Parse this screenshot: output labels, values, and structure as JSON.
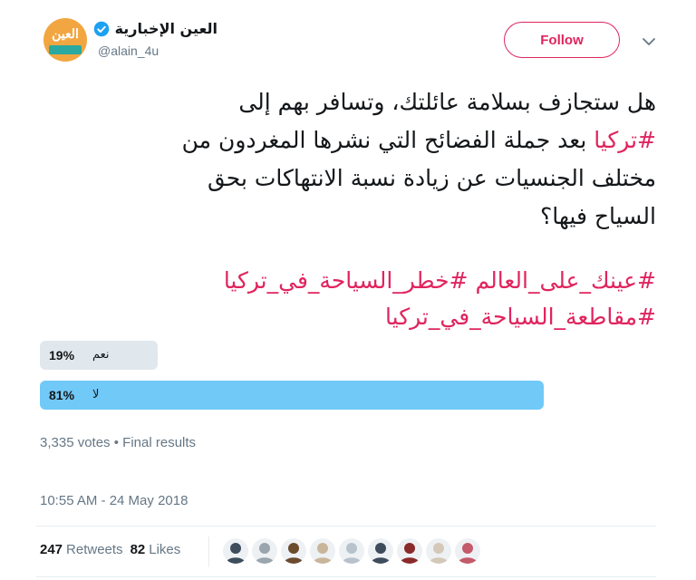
{
  "account": {
    "display_name": "العين الإخبارية",
    "handle": "@alain_4u",
    "avatar_text": "العين",
    "avatar_subtext": "الإخبارية",
    "verified_icon": "verified-badge-icon",
    "brand_color": "#f2a641",
    "brand_accent": "#2aa9a0"
  },
  "actions": {
    "follow_label": "Follow",
    "follow_color": "#e0245e",
    "menu_icon": "chevron-down-icon"
  },
  "tweet": {
    "line1": "هل ستجازف بسلامة عائلتك، وتسافر بهم إلى",
    "line2_hashtag": "#تركيا",
    "line2_text": " بعد جملة الفضائح التي نشرها المغردون من",
    "line3": "مختلف الجنسيات عن زيادة نسبة الانتهاكات بحق",
    "line4": "السياح فيها؟",
    "hashtags_line1": "#عينك_على_العالم #خطر_السياحة_في_تركيا",
    "hashtags_line2": "#مقاطعة_السياحة_في_تركيا",
    "hashtag_color": "#e0245e"
  },
  "poll": {
    "options": [
      {
        "label": "نعم",
        "percent_text": "19%",
        "percent": 19,
        "winner": false
      },
      {
        "label": "لا",
        "percent_text": "81%",
        "percent": 81,
        "winner": true
      }
    ],
    "votes_text": "3,335 votes",
    "status_text": "Final results",
    "separator": "•",
    "winner_color": "#71c9f8",
    "loser_color": "#e1e8ed"
  },
  "timestamp": "10:55 AM - 24 May 2018",
  "stats": {
    "retweets_count": "247",
    "retweets_label": "Retweets",
    "likes_count": "82",
    "likes_label": "Likes"
  },
  "likers": [
    {
      "name": "liker-avatar-1",
      "color": "#3d4d5c"
    },
    {
      "name": "liker-avatar-2",
      "color": "#9aa5ad"
    },
    {
      "name": "liker-avatar-3",
      "color": "#6b4a2e"
    },
    {
      "name": "liker-avatar-4",
      "color": "#c9b59a"
    },
    {
      "name": "liker-avatar-5",
      "color": "#b8c2cc"
    },
    {
      "name": "liker-avatar-6",
      "color": "#3d4d5c"
    },
    {
      "name": "liker-avatar-7",
      "color": "#8b2a2a"
    },
    {
      "name": "liker-avatar-8",
      "color": "#d4c8b8"
    },
    {
      "name": "liker-avatar-9",
      "color": "#c45a6a"
    }
  ]
}
